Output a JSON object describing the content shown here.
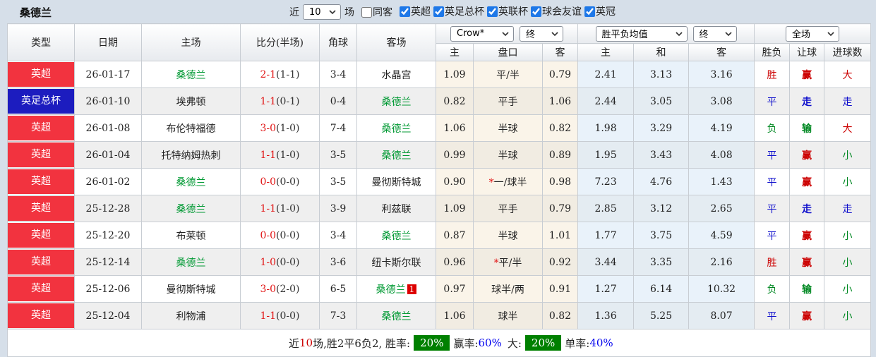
{
  "title": "桑德兰",
  "topbar": {
    "recent_label": "近",
    "recent_value": "10",
    "matches_label": "场",
    "same_away_label": "同客",
    "same_away_checked": false,
    "leagues": [
      {
        "label": "英超",
        "checked": true
      },
      {
        "label": "英足总杯",
        "checked": true
      },
      {
        "label": "英联杯",
        "checked": true
      },
      {
        "label": "球会友谊",
        "checked": true
      },
      {
        "label": "英冠",
        "checked": true
      }
    ]
  },
  "header": {
    "col_type": "类型",
    "col_date": "日期",
    "col_home": "主场",
    "col_score": "比分(半场)",
    "col_corner": "角球",
    "col_away": "客场",
    "ah_select": "Crow*",
    "ah_period_select": "终",
    "ah_cols": [
      "主",
      "盘口",
      "客"
    ],
    "eu_select": "胜平负均值",
    "eu_period_select": "终",
    "eu_cols": [
      "主",
      "和",
      "客"
    ],
    "res_select": "全场",
    "res_cols": [
      "胜负",
      "让球",
      "进球数"
    ]
  },
  "colors": {
    "league_premier_badge": "#f2333f",
    "league_fa_cup_badge": "#1c1cbf",
    "self_team_green": "#009933",
    "win_red": "#cc0000",
    "draw_blue": "#0f0fcc",
    "loss_green": "#008822",
    "score_red": "#e11414",
    "rate_badge_green": "#008000",
    "rate_value_blue": "#0000ee"
  },
  "rows": [
    {
      "type": "英超",
      "type_color": "red",
      "date": "26-01-17",
      "home": "桑德兰",
      "home_self": true,
      "score": "2-1",
      "half": "(1-1)",
      "corner": "3-4",
      "away": "水晶宫",
      "away_self": false,
      "away_card": "",
      "ah_home": "1.09",
      "handicap_star": "",
      "handicap": "平/半",
      "ah_away": "0.79",
      "eu_home": "2.41",
      "eu_draw": "3.13",
      "eu_away": "3.16",
      "result": "胜",
      "result_color": "red",
      "let_result": "赢",
      "let_color": "red",
      "goal_result": "大",
      "goal_color": "red"
    },
    {
      "type": "英足总杯",
      "type_color": "blue",
      "date": "26-01-10",
      "home": "埃弗顿",
      "home_self": false,
      "score": "1-1",
      "half": "(0-1)",
      "corner": "0-4",
      "away": "桑德兰",
      "away_self": true,
      "away_card": "",
      "ah_home": "0.82",
      "handicap_star": "",
      "handicap": "平手",
      "ah_away": "1.06",
      "eu_home": "2.44",
      "eu_draw": "3.05",
      "eu_away": "3.08",
      "result": "平",
      "result_color": "blue",
      "let_result": "走",
      "let_color": "blue",
      "goal_result": "走",
      "goal_color": "blue"
    },
    {
      "type": "英超",
      "type_color": "red",
      "date": "26-01-08",
      "home": "布伦特福德",
      "home_self": false,
      "score": "3-0",
      "half": "(1-0)",
      "corner": "7-4",
      "away": "桑德兰",
      "away_self": true,
      "away_card": "",
      "ah_home": "1.06",
      "handicap_star": "",
      "handicap": "半球",
      "ah_away": "0.82",
      "eu_home": "1.98",
      "eu_draw": "3.29",
      "eu_away": "4.19",
      "result": "负",
      "result_color": "green",
      "let_result": "输",
      "let_color": "green",
      "goal_result": "大",
      "goal_color": "red"
    },
    {
      "type": "英超",
      "type_color": "red",
      "date": "26-01-04",
      "home": "托特纳姆热刺",
      "home_self": false,
      "score": "1-1",
      "half": "(1-0)",
      "corner": "3-5",
      "away": "桑德兰",
      "away_self": true,
      "away_card": "",
      "ah_home": "0.99",
      "handicap_star": "",
      "handicap": "半球",
      "ah_away": "0.89",
      "eu_home": "1.95",
      "eu_draw": "3.43",
      "eu_away": "4.08",
      "result": "平",
      "result_color": "blue",
      "let_result": "赢",
      "let_color": "red",
      "goal_result": "小",
      "goal_color": "green"
    },
    {
      "type": "英超",
      "type_color": "red",
      "date": "26-01-02",
      "home": "桑德兰",
      "home_self": true,
      "score": "0-0",
      "half": "(0-0)",
      "corner": "3-5",
      "away": "曼彻斯特城",
      "away_self": false,
      "away_card": "",
      "ah_home": "0.90",
      "handicap_star": "*",
      "handicap": "一/球半",
      "ah_away": "0.98",
      "eu_home": "7.23",
      "eu_draw": "4.76",
      "eu_away": "1.43",
      "result": "平",
      "result_color": "blue",
      "let_result": "赢",
      "let_color": "red",
      "goal_result": "小",
      "goal_color": "green"
    },
    {
      "type": "英超",
      "type_color": "red",
      "date": "25-12-28",
      "home": "桑德兰",
      "home_self": true,
      "score": "1-1",
      "half": "(1-0)",
      "corner": "3-9",
      "away": "利兹联",
      "away_self": false,
      "away_card": "",
      "ah_home": "1.09",
      "handicap_star": "",
      "handicap": "平手",
      "ah_away": "0.79",
      "eu_home": "2.85",
      "eu_draw": "3.12",
      "eu_away": "2.65",
      "result": "平",
      "result_color": "blue",
      "let_result": "走",
      "let_color": "blue",
      "goal_result": "走",
      "goal_color": "blue"
    },
    {
      "type": "英超",
      "type_color": "red",
      "date": "25-12-20",
      "home": "布莱顿",
      "home_self": false,
      "score": "0-0",
      "half": "(0-0)",
      "corner": "3-4",
      "away": "桑德兰",
      "away_self": true,
      "away_card": "",
      "ah_home": "0.87",
      "handicap_star": "",
      "handicap": "半球",
      "ah_away": "1.01",
      "eu_home": "1.77",
      "eu_draw": "3.75",
      "eu_away": "4.59",
      "result": "平",
      "result_color": "blue",
      "let_result": "赢",
      "let_color": "red",
      "goal_result": "小",
      "goal_color": "green"
    },
    {
      "type": "英超",
      "type_color": "red",
      "date": "25-12-14",
      "home": "桑德兰",
      "home_self": true,
      "score": "1-0",
      "half": "(0-0)",
      "corner": "3-6",
      "away": "纽卡斯尔联",
      "away_self": false,
      "away_card": "",
      "ah_home": "0.96",
      "handicap_star": "*",
      "handicap": "平/半",
      "ah_away": "0.92",
      "eu_home": "3.44",
      "eu_draw": "3.35",
      "eu_away": "2.16",
      "result": "胜",
      "result_color": "red",
      "let_result": "赢",
      "let_color": "red",
      "goal_result": "小",
      "goal_color": "green"
    },
    {
      "type": "英超",
      "type_color": "red",
      "date": "25-12-06",
      "home": "曼彻斯特城",
      "home_self": false,
      "score": "3-0",
      "half": "(2-0)",
      "corner": "6-5",
      "away": "桑德兰",
      "away_self": true,
      "away_card": "1",
      "ah_home": "0.97",
      "handicap_star": "",
      "handicap": "球半/两",
      "ah_away": "0.91",
      "eu_home": "1.27",
      "eu_draw": "6.14",
      "eu_away": "10.32",
      "result": "负",
      "result_color": "green",
      "let_result": "输",
      "let_color": "green",
      "goal_result": "小",
      "goal_color": "green"
    },
    {
      "type": "英超",
      "type_color": "red",
      "date": "25-12-04",
      "home": "利物浦",
      "home_self": false,
      "score": "1-1",
      "half": "(0-0)",
      "corner": "7-3",
      "away": "桑德兰",
      "away_self": true,
      "away_card": "",
      "ah_home": "1.06",
      "handicap_star": "",
      "handicap": "球半",
      "ah_away": "0.82",
      "eu_home": "1.36",
      "eu_draw": "5.25",
      "eu_away": "8.07",
      "result": "平",
      "result_color": "blue",
      "let_result": "赢",
      "let_color": "red",
      "goal_result": "小",
      "goal_color": "green"
    }
  ],
  "footer": {
    "prefix": "近",
    "count": "10",
    "stats": "场,胜2平6负2, 胜率:",
    "win_rate": "20%",
    "handicap_label": "赢率:",
    "handicap_rate": "60%",
    "big_label": "大:",
    "big_rate": "20%",
    "single_label": "单率:",
    "single_rate": "40%"
  }
}
